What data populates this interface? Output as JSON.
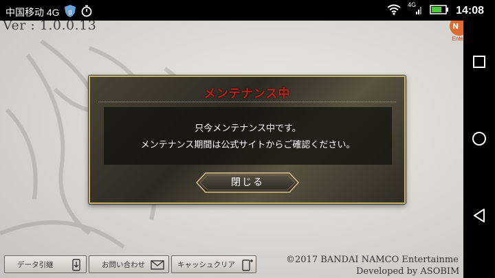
{
  "status_bar": {
    "carrier": "中国移动 4G",
    "network": "4G",
    "time": "14:08",
    "icons": [
      "shield-icon",
      "stopwatch-icon",
      "wifi-icon",
      "signal-icon",
      "battery-icon"
    ]
  },
  "game": {
    "version": "Ver : 1.0.0.13",
    "logo_letter": "N",
    "logo_text": "Ente",
    "copyright_line1": "©2017 BANDAI NAMCO Entertainme",
    "copyright_line2": "Developed by ASOBIM"
  },
  "dialog": {
    "title": "メンテナンス中",
    "message_line1": "只今メンテナンス中です。",
    "message_line2": "メンテナンス期間は公式サイトからご確認ください。",
    "close_button": "閉じる"
  },
  "bottom_buttons": [
    {
      "label": "データ引継",
      "icon": "phone-transfer-icon"
    },
    {
      "label": "お問い合わせ",
      "icon": "mail-icon"
    },
    {
      "label": "キャッシュクリア",
      "icon": "cache-clear-icon"
    }
  ],
  "nav_bar": {
    "buttons": [
      "recents-button",
      "home-button",
      "back-button"
    ]
  },
  "colors": {
    "title_red": "#c0201a",
    "dialog_border": "#cbb57a",
    "orange_logo": "#e26a2c"
  }
}
